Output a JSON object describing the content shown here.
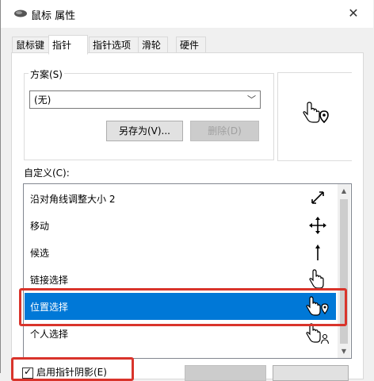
{
  "window": {
    "title": "鼠标 属性",
    "close_glyph": "✕"
  },
  "tabs": [
    {
      "label": "鼠标键"
    },
    {
      "label": "指针",
      "active": true
    },
    {
      "label": "指针选项"
    },
    {
      "label": "滑轮"
    },
    {
      "label": "硬件"
    }
  ],
  "scheme": {
    "label": "方案(S)",
    "selected": "(无)",
    "save_as_label": "另存为(V)...",
    "delete_label": "删除(D)"
  },
  "custom": {
    "label": "自定义(C):",
    "items": [
      {
        "label": "沿对角线调整大小 2",
        "icon": "diagonal-resize-icon"
      },
      {
        "label": "移动",
        "icon": "move-icon"
      },
      {
        "label": "候选",
        "icon": "up-arrow-icon"
      },
      {
        "label": "链接选择",
        "icon": "hand-icon"
      },
      {
        "label": "位置选择",
        "icon": "hand-pin-icon",
        "selected": true
      },
      {
        "label": "个人选择",
        "icon": "hand-person-icon"
      }
    ]
  },
  "shadow": {
    "label": "启用指针阴影(E)",
    "checked": true
  },
  "colors": {
    "selection": "#0078d7",
    "highlight": "#d9342b"
  }
}
